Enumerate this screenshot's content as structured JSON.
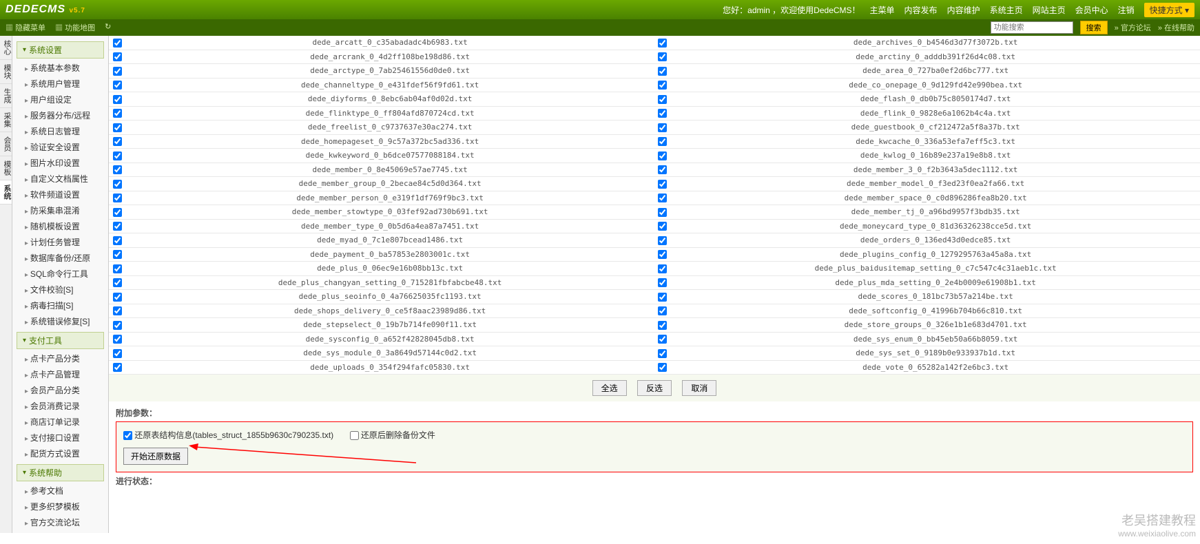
{
  "header": {
    "logo": "DEDECMS",
    "ver": "v5.7",
    "welcome": "您好：admin ，欢迎使用DedeCMS！",
    "links": [
      "主菜单",
      "内容发布",
      "内容维护",
      "系统主页",
      "网站主页",
      "会员中心",
      "注销"
    ],
    "quick": "快捷方式 ▾"
  },
  "subheader": {
    "left": [
      "隐藏菜单",
      "功能地图"
    ],
    "search_placeholder": "功能搜索",
    "search_btn": "搜索",
    "right": [
      "官方论坛",
      "在线帮助"
    ]
  },
  "vtabs": [
    "核心",
    "模块",
    "生成",
    "采集",
    "会员",
    "模板",
    "系统"
  ],
  "vtab_selected": 6,
  "sidebar": [
    {
      "title": "系统设置",
      "items": [
        "系统基本参数",
        "系统用户管理",
        "用户组设定",
        "服务器分布/远程",
        "系统日志管理",
        "验证安全设置",
        "图片水印设置",
        "自定义文档属性",
        "软件频道设置",
        "防采集串混淆",
        "随机模板设置",
        "计划任务管理",
        "数据库备份/还原",
        "SQL命令行工具",
        "文件校验[S]",
        "病毒扫描[S]",
        "系统错误修复[S]"
      ]
    },
    {
      "title": "支付工具",
      "items": [
        "点卡产品分类",
        "点卡产品管理",
        "会员产品分类",
        "会员消费记录",
        "商店订单记录",
        "支付接口设置",
        "配货方式设置"
      ]
    },
    {
      "title": "系统帮助",
      "items": [
        "参考文档",
        "更多织梦模板",
        "官方交流论坛"
      ]
    }
  ],
  "files_left": [
    "dede_arcatt_0_c35abadadc4b6983.txt",
    "dede_arcrank_0_4d2ff108be198d86.txt",
    "dede_arctype_0_7ab25461556d0de0.txt",
    "dede_channeltype_0_e431fdef56f9fd61.txt",
    "dede_diyforms_0_8ebc6ab04af0d02d.txt",
    "dede_flinktype_0_ff804afd870724cd.txt",
    "dede_freelist_0_c9737637e30ac274.txt",
    "dede_homepageset_0_9c57a372bc5ad336.txt",
    "dede_kwkeyword_0_b6dce07577088184.txt",
    "dede_member_0_8e45069e57ae7745.txt",
    "dede_member_group_0_2becae84c5d0d364.txt",
    "dede_member_person_0_e319f1df769f9bc3.txt",
    "dede_member_stowtype_0_03fef92ad730b691.txt",
    "dede_member_type_0_0b5d6a4ea87a7451.txt",
    "dede_myad_0_7c1e807bcead1486.txt",
    "dede_payment_0_ba57853e2803001c.txt",
    "dede_plus_0_06ec9e16b08bb13c.txt",
    "dede_plus_changyan_setting_0_715281fbfabcbe48.txt",
    "dede_plus_seoinfo_0_4a76625035fc1193.txt",
    "dede_shops_delivery_0_ce5f8aac23989d86.txt",
    "dede_stepselect_0_19b7b714fe090f11.txt",
    "dede_sysconfig_0_a652f42828045db8.txt",
    "dede_sys_module_0_3a8649d57144c0d2.txt",
    "dede_uploads_0_354f294fafc05830.txt"
  ],
  "files_right": [
    "dede_archives_0_b4546d3d77f3072b.txt",
    "dede_arctiny_0_adddb391f26d4c08.txt",
    "dede_area_0_727ba0ef2d6bc777.txt",
    "dede_co_onepage_0_9d129fd42e990bea.txt",
    "dede_flash_0_db0b75c8050174d7.txt",
    "dede_flink_0_9828e6a1062b4c4a.txt",
    "dede_guestbook_0_cf212472a5f8a37b.txt",
    "dede_kwcache_0_336a53efa7eff5c3.txt",
    "dede_kwlog_0_16b89e237a19e8b8.txt",
    "dede_member_3_0_f2b3643a5dec1112.txt",
    "dede_member_model_0_f3ed23f0ea2fa66.txt",
    "dede_member_space_0_c0d896286fea8b20.txt",
    "dede_member_tj_0_a96bd9957f3bdb35.txt",
    "dede_moneycard_type_0_81d36326238cce5d.txt",
    "dede_orders_0_136ed43d0edce85.txt",
    "dede_plugins_config_0_1279295763a45a8a.txt",
    "dede_plus_baidusitemap_setting_0_c7c547c4c31aeb1c.txt",
    "dede_plus_mda_setting_0_2e4b0009e61908b1.txt",
    "dede_scores_0_181bc73b57a214be.txt",
    "dede_softconfig_0_41996b704b66c810.txt",
    "dede_store_groups_0_326e1b1e683d4701.txt",
    "dede_sys_enum_0_bb45eb50a66b8059.txt",
    "dede_sys_set_0_9189b0e933937b1d.txt",
    "dede_vote_0_65282a142f2e6bc3.txt"
  ],
  "btns": {
    "all": "全选",
    "inv": "反选",
    "cancel": "取消"
  },
  "params_label": "附加参数：",
  "restore_struct_label": "还原表结构信息(tables_struct_1855b9630c790235.txt)",
  "delete_after_label": "还原后删除备份文件",
  "start_btn": "开始还原数据",
  "status_label": "进行状态：",
  "watermark": {
    "t1": "老吴搭建教程",
    "t2": "www.weixiaolive.com"
  }
}
